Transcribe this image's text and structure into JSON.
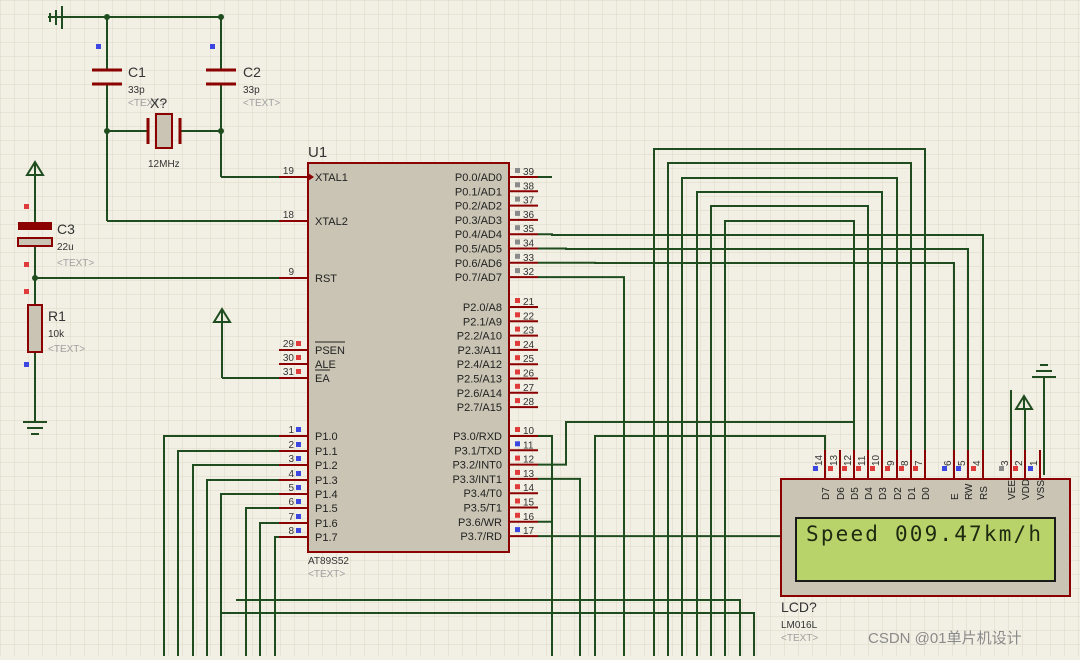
{
  "colors": {
    "background": "#f2f0e4",
    "grid": "#dcd9c6",
    "wire": "#1f4d1f",
    "component": "#8b0000",
    "chip_fill": "#c9c4b3",
    "lcd_screen": "#b9d36b",
    "lcd_text": "#1e2a10",
    "pin_red": "#e03b3b",
    "pin_blue": "#3b47e0",
    "pin_gray": "#8a8a8a",
    "ref_text": "#333333",
    "placeholder_text": "#a0a0a0"
  },
  "components": {
    "c1": {
      "ref": "C1",
      "value": "33p",
      "text": "<TEXT>"
    },
    "c2": {
      "ref": "C2",
      "value": "33p",
      "text": "<TEXT>"
    },
    "crystal": {
      "ref": "X?",
      "value": "12MHz"
    },
    "c3": {
      "ref": "C3",
      "value": "22u",
      "text": "<TEXT>"
    },
    "r1": {
      "ref": "R1",
      "value": "10k",
      "text": "<TEXT>"
    },
    "u1": {
      "ref": "U1",
      "part": "AT89S52",
      "text": "<TEXT>",
      "left_pins": [
        {
          "num": "19",
          "name": "XTAL1"
        },
        {
          "num": "18",
          "name": "XTAL2"
        },
        {
          "num": "9",
          "name": "RST"
        },
        {
          "num": "29",
          "name": "PSEN"
        },
        {
          "num": "30",
          "name": "ALE"
        },
        {
          "num": "31",
          "name": "EA"
        },
        {
          "num": "1",
          "name": "P1.0"
        },
        {
          "num": "2",
          "name": "P1.1"
        },
        {
          "num": "3",
          "name": "P1.2"
        },
        {
          "num": "4",
          "name": "P1.3"
        },
        {
          "num": "5",
          "name": "P1.4"
        },
        {
          "num": "6",
          "name": "P1.5"
        },
        {
          "num": "7",
          "name": "P1.6"
        },
        {
          "num": "8",
          "name": "P1.7"
        }
      ],
      "right_pins": [
        {
          "num": "39",
          "name": "P0.0/AD0"
        },
        {
          "num": "38",
          "name": "P0.1/AD1"
        },
        {
          "num": "37",
          "name": "P0.2/AD2"
        },
        {
          "num": "36",
          "name": "P0.3/AD3"
        },
        {
          "num": "35",
          "name": "P0.4/AD4"
        },
        {
          "num": "34",
          "name": "P0.5/AD5"
        },
        {
          "num": "33",
          "name": "P0.6/AD6"
        },
        {
          "num": "32",
          "name": "P0.7/AD7"
        },
        {
          "num": "21",
          "name": "P2.0/A8"
        },
        {
          "num": "22",
          "name": "P2.1/A9"
        },
        {
          "num": "23",
          "name": "P2.2/A10"
        },
        {
          "num": "24",
          "name": "P2.3/A11"
        },
        {
          "num": "25",
          "name": "P2.4/A12"
        },
        {
          "num": "26",
          "name": "P2.5/A13"
        },
        {
          "num": "27",
          "name": "P2.6/A14"
        },
        {
          "num": "28",
          "name": "P2.7/A15"
        },
        {
          "num": "10",
          "name": "P3.0/RXD"
        },
        {
          "num": "11",
          "name": "P3.1/TXD"
        },
        {
          "num": "12",
          "name": "P3.2/INT0"
        },
        {
          "num": "13",
          "name": "P3.3/INT1"
        },
        {
          "num": "14",
          "name": "P3.4/T0"
        },
        {
          "num": "15",
          "name": "P3.5/T1"
        },
        {
          "num": "16",
          "name": "P3.6/WR"
        },
        {
          "num": "17",
          "name": "P3.7/RD"
        }
      ]
    },
    "lcd": {
      "ref": "LCD?",
      "part": "LM016L",
      "text": "<TEXT>",
      "display": "Speed 009.47km/h",
      "pins": [
        {
          "num": "14",
          "name": "D7"
        },
        {
          "num": "13",
          "name": "D6"
        },
        {
          "num": "12",
          "name": "D5"
        },
        {
          "num": "11",
          "name": "D4"
        },
        {
          "num": "10",
          "name": "D3"
        },
        {
          "num": "9",
          "name": "D2"
        },
        {
          "num": "8",
          "name": "D1"
        },
        {
          "num": "7",
          "name": "D0"
        },
        {
          "num": "6",
          "name": "E"
        },
        {
          "num": "5",
          "name": "RW"
        },
        {
          "num": "4",
          "name": "RS"
        },
        {
          "num": "3",
          "name": "VEE"
        },
        {
          "num": "2",
          "name": "VDD"
        },
        {
          "num": "1",
          "name": "VSS"
        }
      ]
    }
  },
  "watermark": "CSDN @01单片机设计"
}
